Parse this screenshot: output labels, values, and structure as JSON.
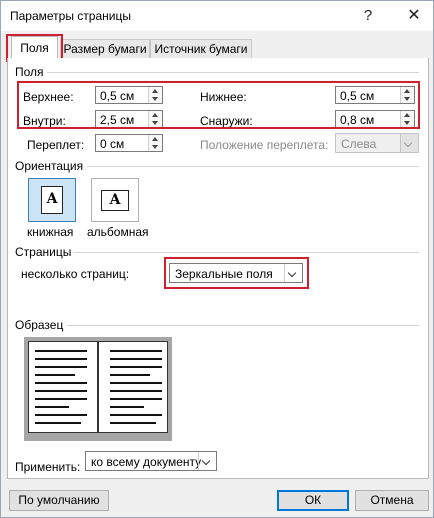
{
  "window": {
    "title": "Параметры страницы",
    "help_glyph": "?",
    "close_glyph": "✕"
  },
  "tabs": [
    {
      "label": "Поля",
      "active": true
    },
    {
      "label": "Размер бумаги",
      "active": false
    },
    {
      "label": "Источник бумаги",
      "active": false
    }
  ],
  "margins": {
    "section_title": "Поля",
    "top": {
      "label": "Верхнее:",
      "value": "0,5 см"
    },
    "bottom": {
      "label": "Нижнее:",
      "value": "0,5 см"
    },
    "inside": {
      "label": "Внутри:",
      "value": "2,5 см"
    },
    "outside": {
      "label": "Снаружи:",
      "value": "0,8 см"
    },
    "gutter": {
      "label": "Переплет:",
      "value": "0 см"
    },
    "gutter_position": {
      "label": "Положение переплета:",
      "value": "Слева"
    }
  },
  "orientation": {
    "section_title": "Ориентация",
    "portrait": {
      "label": "книжная",
      "letter": "A",
      "selected": true
    },
    "landscape": {
      "label": "альбомная",
      "letter": "A",
      "selected": false
    }
  },
  "pages": {
    "section_title": "Страницы",
    "multiple_label": "несколько страниц:",
    "multiple_value": "Зеркальные поля"
  },
  "preview": {
    "section_title": "Образец"
  },
  "apply": {
    "label": "Применить:",
    "value": "ко всему документу"
  },
  "buttons": {
    "default_label": "По умолчанию",
    "ok_label": "ОК",
    "cancel_label": "Отмена"
  },
  "colors": {
    "highlight": "#d0202f",
    "selected_fill": "#cce4f7",
    "accent": "#0078d7"
  }
}
